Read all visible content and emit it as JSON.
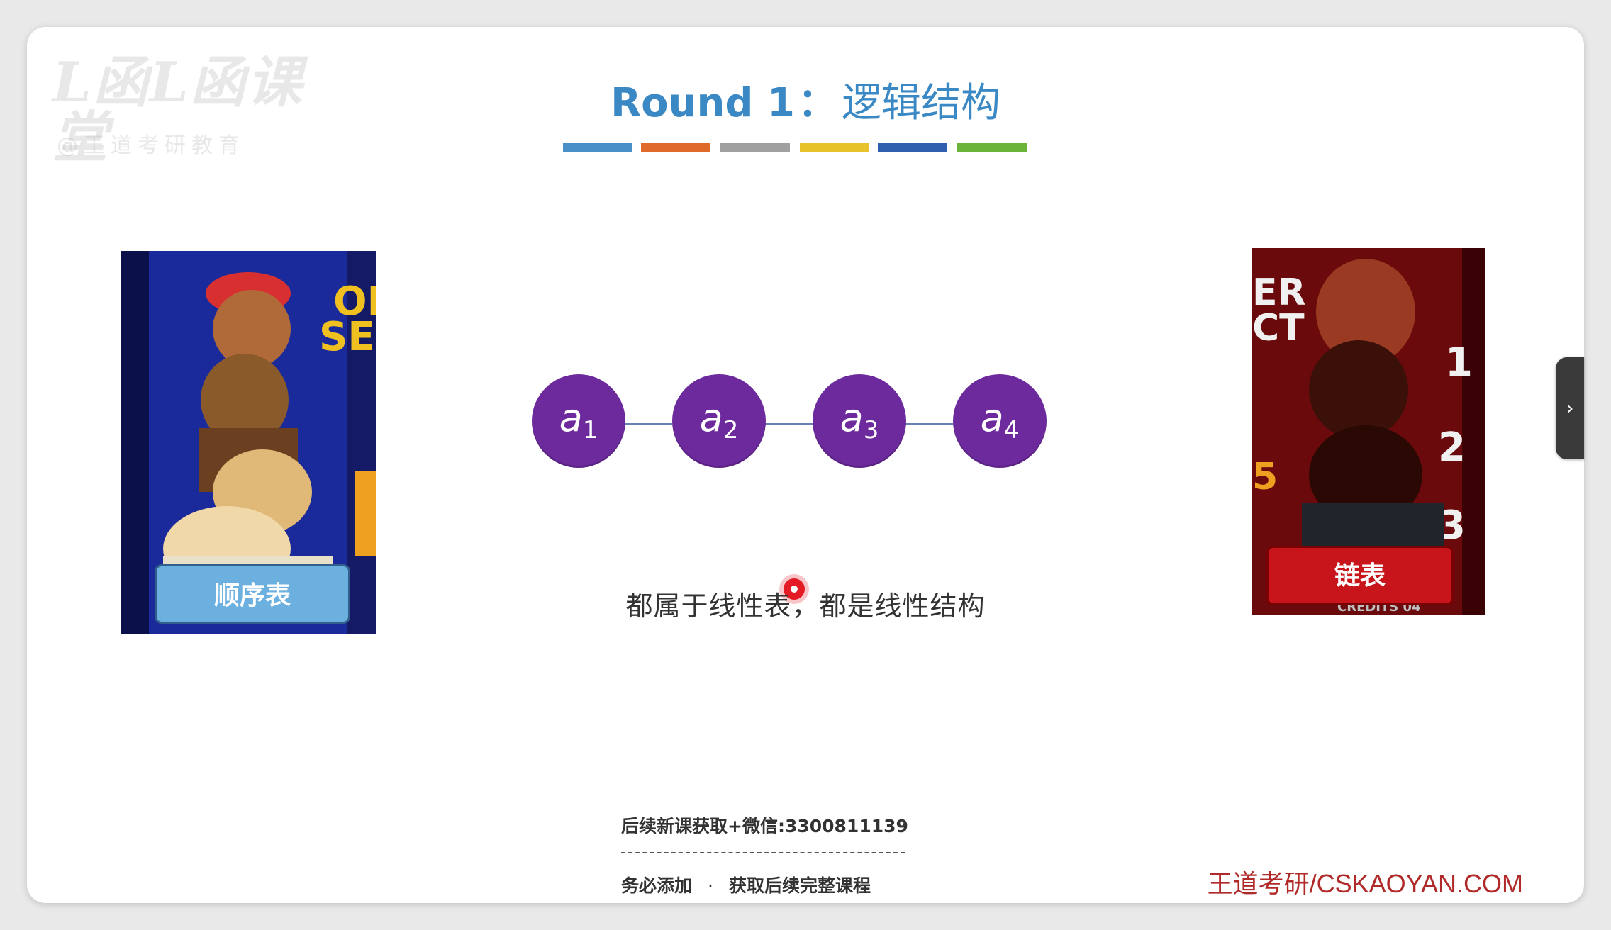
{
  "watermark": {
    "main": "L函L函课堂",
    "sub": "@王道考研教育"
  },
  "slide": {
    "title_en": "Round 1",
    "title_sep": "：",
    "title_cn": "逻辑结构",
    "color_bar": [
      "#4a90c8",
      "#e06a2a",
      "#a0a0a0",
      "#e8c22a",
      "#2f5fae",
      "#6ab43a"
    ]
  },
  "cards": {
    "left_label": "顺序表",
    "right_label": "链表"
  },
  "nodes": [
    {
      "base": "a",
      "sub": "1"
    },
    {
      "base": "a",
      "sub": "2"
    },
    {
      "base": "a",
      "sub": "3"
    },
    {
      "base": "a",
      "sub": "4"
    }
  ],
  "caption": "都属于线性表，都是线性结构",
  "notice": {
    "line1": "后续新课获取+微信:3300811139",
    "line2a": "务必添加",
    "dot": "·",
    "line2b": "获取后续完整课程"
  },
  "site": "王道考研/CSKAOYAN.COM",
  "side_tab_icon": "›",
  "colors": {
    "title": "#3a88c4",
    "node": "#6c2a9d",
    "site": "#b02a2a",
    "pointer": "#e41b24"
  }
}
